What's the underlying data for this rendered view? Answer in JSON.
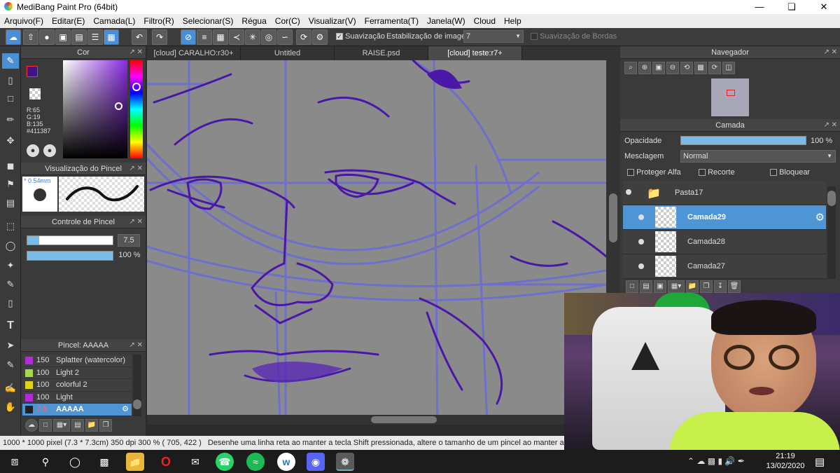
{
  "window": {
    "title": "MediBang Paint Pro (64bit)"
  },
  "menu": [
    "Arquivo(F)",
    "Editar(E)",
    "Camada(L)",
    "Filtro(R)",
    "Selecionar(S)",
    "Régua",
    "Cor(C)",
    "Visualizar(V)",
    "Ferramenta(T)",
    "Janela(W)",
    "Cloud",
    "Help"
  ],
  "toolbar": {
    "suavizacao_label": "Suavização",
    "estabilizacao_label": "Estabilização de imagens",
    "estabilizacao_value": "7",
    "suavizacao_bordas_label": "Suavização de Bordas"
  },
  "color_panel": {
    "title": "Cor",
    "r": "R:65",
    "g": "G:19",
    "b": "B:135",
    "hex": "#411387",
    "current_color": "#411387"
  },
  "brush_preview": {
    "title": "Visualização do Pincel",
    "size": "* 0.54mm"
  },
  "brush_control": {
    "title": "Controle de Pincel",
    "size_value": "7.5",
    "opacity_value": "100 %"
  },
  "brush_list": {
    "title": "Pincel: AAAAA",
    "items": [
      {
        "size": "150",
        "name": "Splatter (watercolor)",
        "color": "#b32ad6"
      },
      {
        "size": "100",
        "name": "Light 2",
        "color": "#a7d64a"
      },
      {
        "size": "100",
        "name": "colorful 2",
        "color": "#e0d21a"
      },
      {
        "size": "100",
        "name": "Light",
        "color": "#b32ad6"
      },
      {
        "size": "7.5",
        "name": "AAAAA",
        "color": "#222222"
      }
    ]
  },
  "tabs": [
    "[cloud] CARALHO:r30+",
    "Untitled",
    "RAISE.psd",
    "[cloud] teste:r7+"
  ],
  "navigator": {
    "title": "Navegador"
  },
  "layer_panel": {
    "title": "Camada",
    "opacity_label": "Opacidade",
    "opacity_value": "100 %",
    "blend_label": "Mesclagem",
    "blend_value": "Normal",
    "protect_alpha": "Proteger Alfa",
    "clip": "Recorte",
    "lock": "Bloquear",
    "layers": [
      {
        "name": "Pasta17"
      },
      {
        "name": "Camada29"
      },
      {
        "name": "Camada28"
      },
      {
        "name": "Camada27"
      }
    ]
  },
  "statusbar": {
    "size": "1000 * 1000 pixel",
    "cm": "(7.3 * 7.3cm)",
    "dpi": "350 dpi",
    "zoom": "300 %",
    "coords": "( 705, 422 )",
    "hint": "Desenhe uma linha reta ao manter a tecla Shift pressionada, altere o tamanho de um pincel ao manter as teclas"
  },
  "taskbar": {
    "time": "21:19",
    "date": "13/02/2020"
  },
  "colors": {
    "accent": "#4f95d6",
    "panel": "#3a3a3a",
    "stroke": "#5a1fa8",
    "guide": "#6a6ad8"
  }
}
